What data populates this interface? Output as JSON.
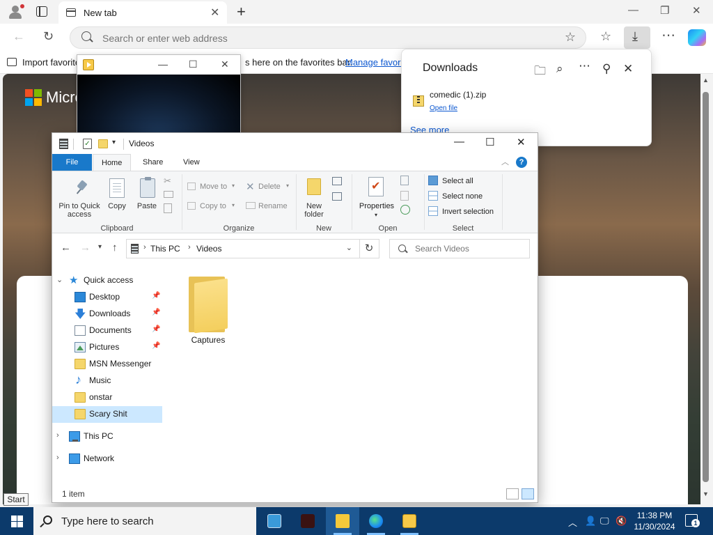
{
  "browser": {
    "tab_title": "New tab",
    "address_placeholder": "Search or enter web address",
    "favorites_bar": {
      "import_label": "Import favorite",
      "hint_text": "s here on the favorites bar.",
      "manage_link": "Manage favori"
    },
    "page": {
      "brand_text": "Micro"
    },
    "logo_colors": [
      "#f25022",
      "#7fba00",
      "#00a4ef",
      "#ffb900"
    ]
  },
  "downloads_panel": {
    "title": "Downloads",
    "items": [
      {
        "file_name": "comedic (1).zip",
        "action": "Open file"
      }
    ],
    "see_more": "See more"
  },
  "explorer": {
    "title": "Videos",
    "ribbon_tabs": [
      "File",
      "Home",
      "Share",
      "View"
    ],
    "help": "?",
    "groups": {
      "clipboard": {
        "label": "Clipboard",
        "pin": "Pin to Quick\naccess",
        "copy": "Copy",
        "paste": "Paste"
      },
      "organize": {
        "label": "Organize",
        "move_to": "Move to",
        "copy_to": "Copy to",
        "delete": "Delete",
        "rename": "Rename"
      },
      "new": {
        "label": "New",
        "new_folder": "New\nfolder"
      },
      "open": {
        "label": "Open",
        "properties": "Properties"
      },
      "select": {
        "label": "Select",
        "select_all": "Select all",
        "select_none": "Select none",
        "invert": "Invert selection"
      }
    },
    "breadcrumb": [
      "This PC",
      "Videos"
    ],
    "search_placeholder": "Search Videos",
    "nav": {
      "quick_access": "Quick access",
      "items": [
        {
          "label": "Desktop",
          "icon": "desktop-icon",
          "pinned": true
        },
        {
          "label": "Downloads",
          "icon": "downloads-icon",
          "pinned": true
        },
        {
          "label": "Documents",
          "icon": "documents-icon",
          "pinned": true
        },
        {
          "label": "Pictures",
          "icon": "pictures-icon",
          "pinned": true
        },
        {
          "label": "MSN Messenger",
          "icon": "folder-icon",
          "pinned": false
        },
        {
          "label": "Music",
          "icon": "music-icon",
          "pinned": false
        },
        {
          "label": "onstar",
          "icon": "folder-icon",
          "pinned": false
        },
        {
          "label": "Scary Shit",
          "icon": "folder-icon",
          "pinned": false,
          "selected": true
        }
      ],
      "this_pc": "This PC",
      "network": "Network"
    },
    "content_items": [
      {
        "label": "Captures",
        "type": "folder"
      }
    ],
    "status": "1 item",
    "accent": "#1979ca",
    "selection_color": "#cce8ff"
  },
  "tooltip": {
    "text": "Start"
  },
  "taskbar": {
    "search_placeholder": "Type here to search",
    "clock_time": "11:38 PM",
    "clock_date": "11/30/2024",
    "notification_count": "1",
    "color": "#0c3a6b"
  }
}
